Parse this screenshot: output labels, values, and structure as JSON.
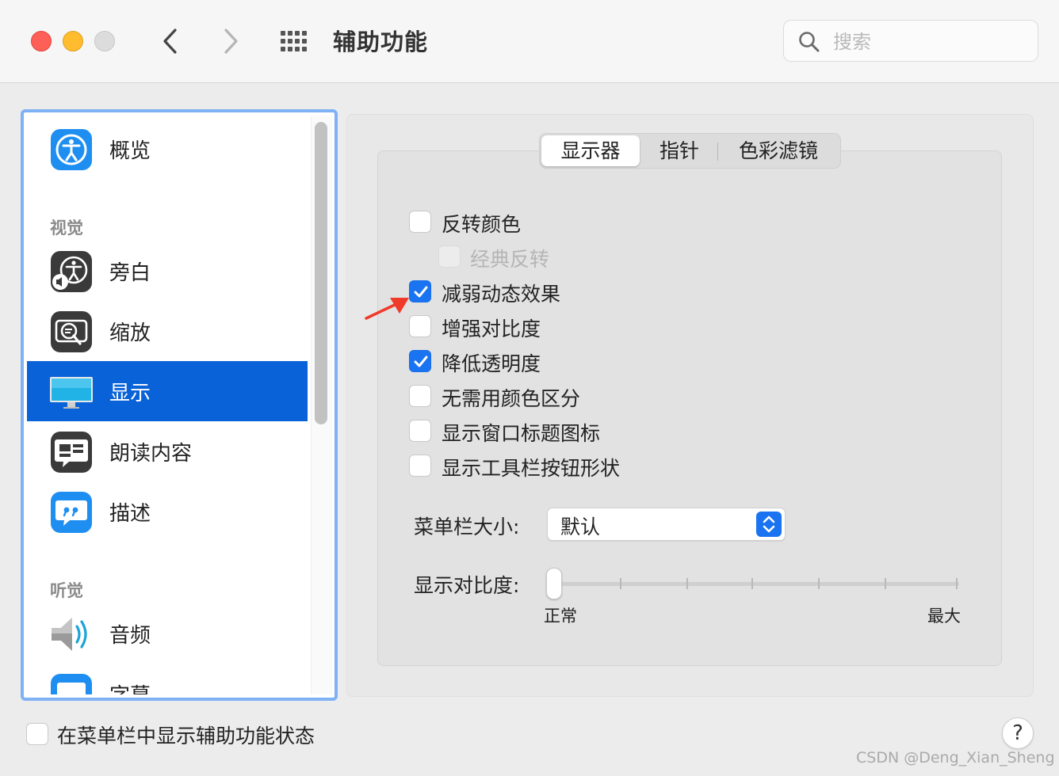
{
  "window": {
    "title": "辅助功能"
  },
  "search": {
    "placeholder": "搜索"
  },
  "sidebar": {
    "items": [
      {
        "label": "概览",
        "icon": "accessibility-icon"
      },
      {
        "label": "旁白",
        "icon": "voiceover-icon"
      },
      {
        "label": "缩放",
        "icon": "zoom-icon"
      },
      {
        "label": "显示",
        "icon": "display-icon",
        "selected": true
      },
      {
        "label": "朗读内容",
        "icon": "spoken-content-icon"
      },
      {
        "label": "描述",
        "icon": "descriptions-icon"
      },
      {
        "label": "音频",
        "icon": "speaker-icon"
      },
      {
        "label": "字幕",
        "icon": "captions-icon"
      }
    ],
    "sections": {
      "vision": "视觉",
      "hearing": "听觉"
    }
  },
  "tabs": [
    {
      "label": "显示器",
      "active": true
    },
    {
      "label": "指针",
      "active": false
    },
    {
      "label": "色彩滤镜",
      "active": false
    }
  ],
  "options": [
    {
      "label": "反转颜色",
      "checked": false,
      "disabled": false
    },
    {
      "label": "经典反转",
      "checked": false,
      "disabled": true
    },
    {
      "label": "减弱动态效果",
      "checked": true,
      "disabled": false
    },
    {
      "label": "增强对比度",
      "checked": false,
      "disabled": false
    },
    {
      "label": "降低透明度",
      "checked": true,
      "disabled": false
    },
    {
      "label": "无需用颜色区分",
      "checked": false,
      "disabled": false
    },
    {
      "label": "显示窗口标题图标",
      "checked": false,
      "disabled": false
    },
    {
      "label": "显示工具栏按钮形状",
      "checked": false,
      "disabled": false
    }
  ],
  "menubar_size": {
    "label": "菜单栏大小:",
    "value": "默认"
  },
  "contrast": {
    "label": "显示对比度:",
    "min_label": "正常",
    "max_label": "最大",
    "value": 0
  },
  "footer": {
    "show_status_label": "在菜单栏中显示辅助功能状态",
    "show_status_checked": false,
    "help_label": "?"
  },
  "watermark": "CSDN @Deng_Xian_Sheng",
  "colors": {
    "accent": "#1a73f0",
    "selection": "#0a62d8",
    "sidebar_focus": "#7fb1f5",
    "annotation_arrow": "#f03a2a"
  }
}
